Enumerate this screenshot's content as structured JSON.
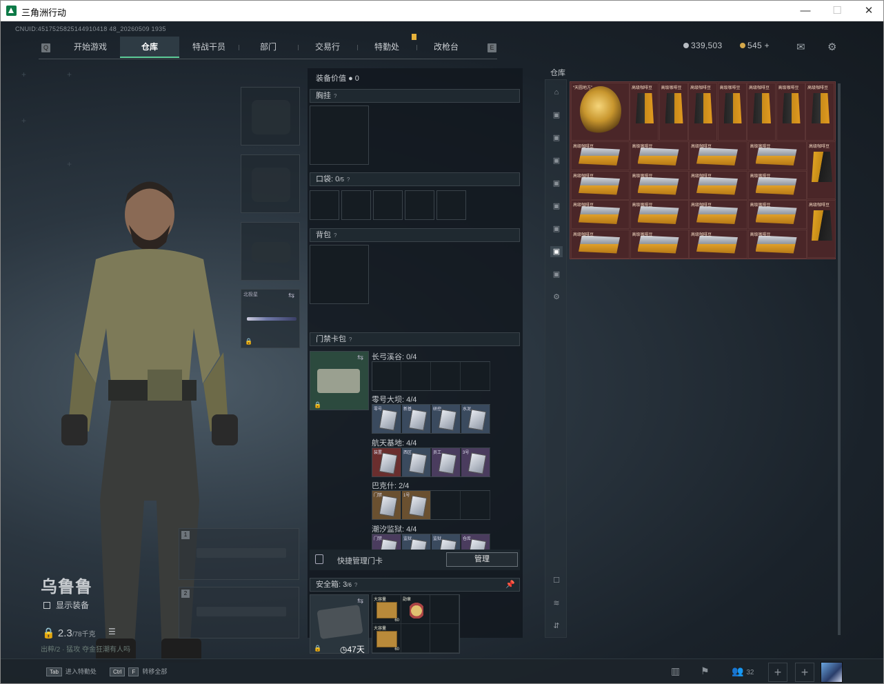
{
  "window": {
    "title": "三角洲行动",
    "minimize": "—",
    "maximize": "☐",
    "close": "✕"
  },
  "uid": "CNUID:4517525825144910418 48_20260509 1935",
  "nav": {
    "tabs": [
      "开始游戏",
      "仓库",
      "特战干员",
      "部门",
      "交易行",
      "特勤处",
      "改枪台"
    ],
    "active": "仓库",
    "left_key": "Q",
    "right_key": "E"
  },
  "currency": {
    "silver": "339,503",
    "gold": "545",
    "plus": "+"
  },
  "character": {
    "name": "乌鲁鲁",
    "show_equip": "显示装备",
    "weight": "2.3",
    "weight_max": "/78千克",
    "status": "出粹/2 · 猛攻 夺金狂潮有人吗"
  },
  "melee": {
    "label": "北极星"
  },
  "weapons": {
    "slot1": "1",
    "slot2": "2"
  },
  "equip": {
    "value_label": "装备价值",
    "value": "0",
    "chest": "胸挂",
    "pocket": "口袋:",
    "pocket_count": "0",
    "pocket_max": "/5",
    "backpack": "背包",
    "cardcase": "门禁卡包",
    "help": "?"
  },
  "cards": [
    {
      "map": "长弓溪谷:",
      "count": "0/4",
      "items": []
    },
    {
      "map": "零号大坝:",
      "count": "4/4",
      "items": [
        "零号",
        "新基",
        "研控",
        "水泥"
      ]
    },
    {
      "map": "航天基地:",
      "count": "4/4",
      "items": [
        "装置",
        "西区",
        "员工",
        "3号"
      ]
    },
    {
      "map": "巴克什:",
      "count": "2/4",
      "items": [
        "门禁",
        "1号"
      ]
    },
    {
      "map": "潮汐监狱:",
      "count": "4/4",
      "items": [
        "门禁",
        "监狱",
        "监狱",
        "仓库"
      ]
    }
  ],
  "quick": {
    "label": "快捷管理门卡",
    "button": "管理"
  },
  "safe": {
    "label": "安全箱:",
    "count": "3",
    "max": "/6",
    "days": "47天",
    "items": [
      {
        "label": "大容量",
        "count": "60"
      },
      {
        "label": "勋章",
        "count": ""
      },
      {
        "label": "大容量",
        "count": "60"
      }
    ]
  },
  "warehouse": {
    "title": "仓库",
    "items": {
      "gyro": "“天圆地方”",
      "coffee": "高级咖啡豆",
      "box": "高级咖啡豆"
    }
  },
  "bottom": {
    "tab_key": "Tab",
    "tab_label": "进入特勤处",
    "ctrl_key": "Ctrl",
    "f_key": "F",
    "transfer": "转移全部",
    "count": "32"
  }
}
